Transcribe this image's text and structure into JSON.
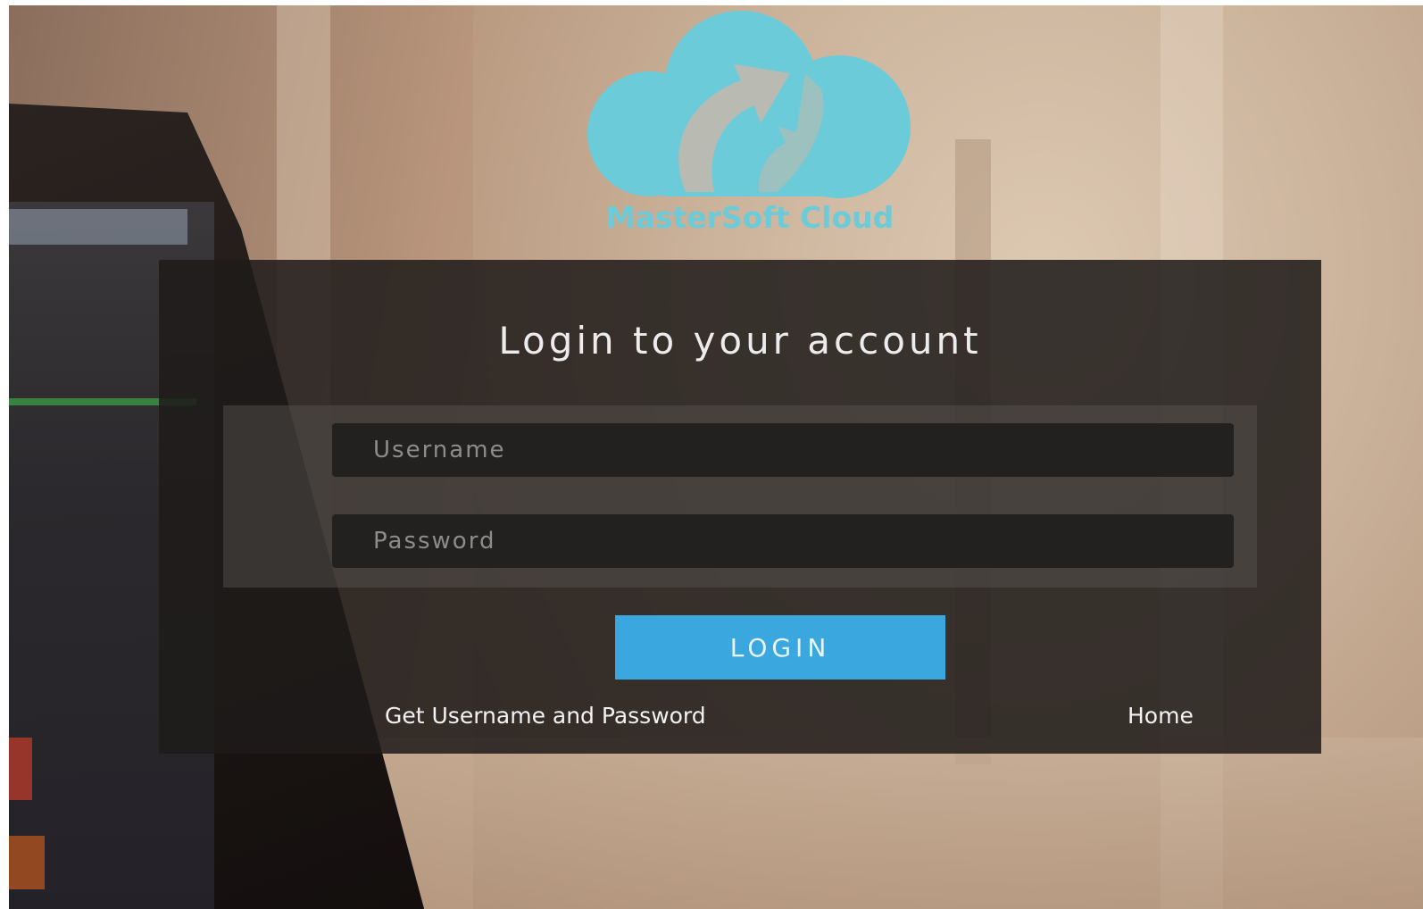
{
  "logo": {
    "text": "MasterSoft Cloud",
    "color": "#6ccbd8",
    "icon": "cloud-arrow-icon"
  },
  "login": {
    "title": "Login to your account",
    "username_placeholder": "Username",
    "password_placeholder": "Password",
    "username_value": "",
    "password_value": "",
    "button_label": "LOGIN",
    "button_color": "#3aa7de"
  },
  "links": {
    "get_credentials": "Get Username and Password",
    "home": "Home"
  }
}
